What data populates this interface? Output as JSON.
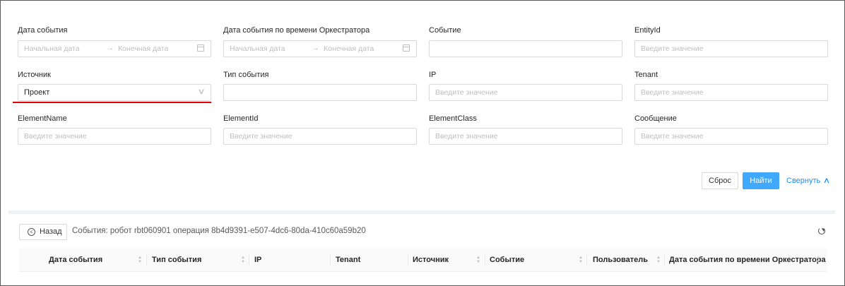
{
  "filters": {
    "event_date": {
      "label": "Дата события",
      "start_placeholder": "Начальная дата",
      "end_placeholder": "Конечная дата",
      "arrow": "→"
    },
    "orchestrator_event_date": {
      "label": "Дата события по времени Оркестратора",
      "start_placeholder": "Начальная дата",
      "end_placeholder": "Конечная дата",
      "arrow": "→"
    },
    "event": {
      "label": "Событие",
      "value": ""
    },
    "entity_id": {
      "label": "EntityId",
      "placeholder": "Введите значение"
    },
    "source": {
      "label": "Источник",
      "value": "Проект"
    },
    "event_type": {
      "label": "Тип события",
      "value": ""
    },
    "ip": {
      "label": "IP",
      "placeholder": "Введите значение"
    },
    "tenant": {
      "label": "Tenant",
      "placeholder": "Введите значение"
    },
    "element_name": {
      "label": "ElementName",
      "placeholder": "Введите значение"
    },
    "element_id": {
      "label": "ElementId",
      "placeholder": "Введите значение"
    },
    "element_class": {
      "label": "ElementClass",
      "placeholder": "Введите значение"
    },
    "message": {
      "label": "Сообщение",
      "placeholder": "Введите значение"
    }
  },
  "actions": {
    "reset_label": "Сброс",
    "find_label": "Найти",
    "collapse_label": "Свернуть"
  },
  "events": {
    "back_label": "Назад",
    "title": "События: робот rbt060901 операция 8b4d9391-e507-4dc6-80da-410c60a59b20",
    "columns": [
      {
        "label": "Дата события",
        "sortable": true
      },
      {
        "label": "Тип события",
        "sortable": true
      },
      {
        "label": "IP",
        "sortable": false
      },
      {
        "label": "Tenant",
        "sortable": false
      },
      {
        "label": "Источник",
        "sortable": true
      },
      {
        "label": "Событие",
        "sortable": true
      },
      {
        "label": "Пользователь",
        "sortable": true
      },
      {
        "label": "Дата события по времени Оркестратора",
        "sortable": true
      }
    ]
  },
  "colors": {
    "primary": "#40a9ff",
    "link": "#1890ff",
    "highlight": "#e00000"
  },
  "icons": [
    "calendar-icon",
    "chevron-down-icon",
    "chevron-up-icon",
    "back-circle-icon",
    "refresh-icon",
    "sort-icon"
  ]
}
